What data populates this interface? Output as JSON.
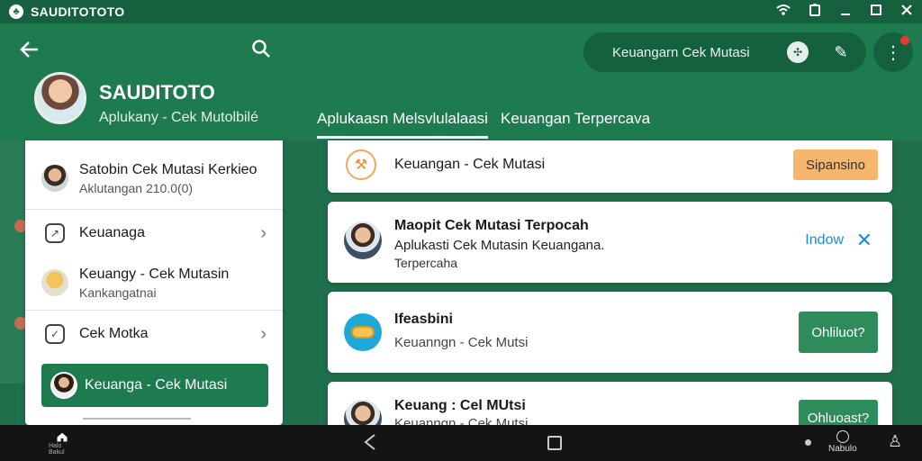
{
  "status_bar": {
    "app_title": "SAUDITOTOTO",
    "icons": [
      "wifi-icon",
      "battery-icon",
      "minimize-icon",
      "maximize-icon",
      "close-icon"
    ]
  },
  "header": {
    "search_pill_text": "Keuangarn Cek Mutasi",
    "profile_name": "SAUDITOTO",
    "profile_sub": "Aplukany - Cek Mutolbilé",
    "tabs": [
      {
        "label": "Aplukaasn Melsvlulalaasi",
        "active": true
      },
      {
        "label": "Keuangan  Terpercava",
        "active": false
      }
    ]
  },
  "sidebar": {
    "items": [
      {
        "title": "Satobin Cek Mutasi Kerkieo",
        "sub": "Aklutangan 210.0(0)"
      },
      {
        "title": "Keuanaga"
      },
      {
        "title": "Keuangy - Cek Mutasin",
        "sub": "Kankangatnai"
      },
      {
        "title": "Cek Motka"
      }
    ],
    "active_item": "Keuanga - Cek Mutasi"
  },
  "cards": [
    {
      "title": "Keuangan - Cek Mutasi",
      "button": "Sipansino"
    },
    {
      "title": "Maopit Cek Mutasi Terpocah",
      "sub": "Aplukasti Cek Mutasin Keuangana.",
      "sub2": "Terpercaha",
      "link": "Indow",
      "close": "✕"
    },
    {
      "title": "Ifeasbini",
      "sub": "Keuanngn - Cek Mutsi",
      "button": "Ohliluot?"
    },
    {
      "title": "Keuang : Cel MUtsi",
      "sub": "Keuanngn - Cek Mutsi",
      "button": "Ohluoast?"
    }
  ],
  "nav_bar": {
    "home_label": "Halo Bakul",
    "clock_label": "Nabulo"
  },
  "colors": {
    "primary": "#1e7a4f",
    "primary_dark": "#15603f",
    "accent_orange": "#f7b66e",
    "link_blue": "#1b8fcf",
    "button_green": "#2e8b5c"
  }
}
